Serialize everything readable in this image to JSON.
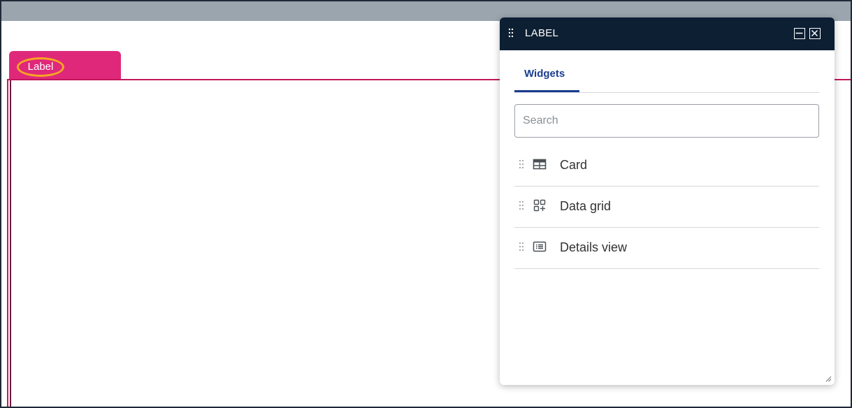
{
  "page_tab": {
    "label": "Label"
  },
  "panel": {
    "title": "LABEL",
    "minimize_icon": "minimize-icon",
    "close_icon": "close-icon",
    "tabs": [
      {
        "label": "Widgets",
        "active": true
      }
    ],
    "search": {
      "placeholder": "Search",
      "value": ""
    },
    "widgets": [
      {
        "label": "Card",
        "icon": "card-icon"
      },
      {
        "label": "Data grid",
        "icon": "data-grid-icon"
      },
      {
        "label": "Details view",
        "icon": "details-view-icon"
      }
    ]
  },
  "colors": {
    "header_bg": "#0d1f33",
    "page_tab": "#e0287a",
    "tab_active": "#1a3d8f",
    "highlight_ring": "#f5a623",
    "top_bar": "#9aa5ad"
  }
}
